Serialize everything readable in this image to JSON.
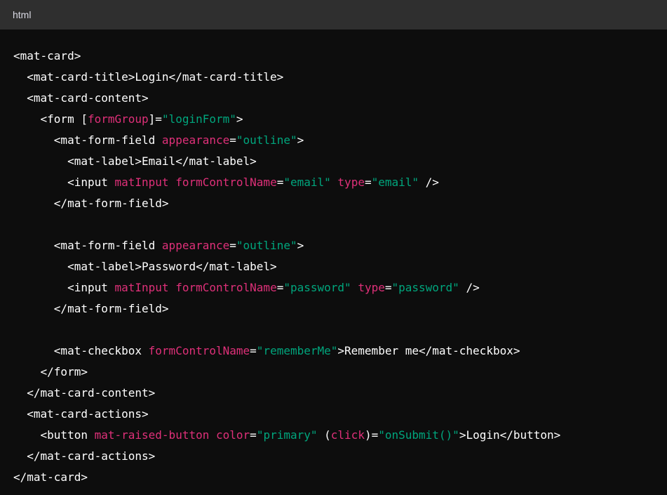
{
  "header": {
    "language": "html"
  },
  "colors": {
    "header_bg": "#2f2f2f",
    "code_bg": "#0d0d0d",
    "tag": "#ffffff",
    "attribute": "#df3079",
    "string": "#00a67d"
  },
  "code_lines": [
    [
      {
        "t": "t",
        "v": "<mat-card>"
      }
    ],
    [
      {
        "t": "t",
        "v": "  <mat-card-title>Login</mat-card-title>"
      }
    ],
    [
      {
        "t": "t",
        "v": "  <mat-card-content>"
      }
    ],
    [
      {
        "t": "t",
        "v": "    <form ["
      },
      {
        "t": "a",
        "v": "formGroup"
      },
      {
        "t": "t",
        "v": "]="
      },
      {
        "t": "s",
        "v": "\"loginForm\""
      },
      {
        "t": "t",
        "v": ">"
      }
    ],
    [
      {
        "t": "t",
        "v": "      <mat-form-field "
      },
      {
        "t": "a",
        "v": "appearance"
      },
      {
        "t": "t",
        "v": "="
      },
      {
        "t": "s",
        "v": "\"outline\""
      },
      {
        "t": "t",
        "v": ">"
      }
    ],
    [
      {
        "t": "t",
        "v": "        <mat-label>Email</mat-label>"
      }
    ],
    [
      {
        "t": "t",
        "v": "        <input "
      },
      {
        "t": "a",
        "v": "matInput"
      },
      {
        "t": "t",
        "v": " "
      },
      {
        "t": "a",
        "v": "formControlName"
      },
      {
        "t": "t",
        "v": "="
      },
      {
        "t": "s",
        "v": "\"email\""
      },
      {
        "t": "t",
        "v": " "
      },
      {
        "t": "a",
        "v": "type"
      },
      {
        "t": "t",
        "v": "="
      },
      {
        "t": "s",
        "v": "\"email\""
      },
      {
        "t": "t",
        "v": " />"
      }
    ],
    [
      {
        "t": "t",
        "v": "      </mat-form-field>"
      }
    ],
    [
      {
        "t": "t",
        "v": ""
      }
    ],
    [
      {
        "t": "t",
        "v": "      <mat-form-field "
      },
      {
        "t": "a",
        "v": "appearance"
      },
      {
        "t": "t",
        "v": "="
      },
      {
        "t": "s",
        "v": "\"outline\""
      },
      {
        "t": "t",
        "v": ">"
      }
    ],
    [
      {
        "t": "t",
        "v": "        <mat-label>Password</mat-label>"
      }
    ],
    [
      {
        "t": "t",
        "v": "        <input "
      },
      {
        "t": "a",
        "v": "matInput"
      },
      {
        "t": "t",
        "v": " "
      },
      {
        "t": "a",
        "v": "formControlName"
      },
      {
        "t": "t",
        "v": "="
      },
      {
        "t": "s",
        "v": "\"password\""
      },
      {
        "t": "t",
        "v": " "
      },
      {
        "t": "a",
        "v": "type"
      },
      {
        "t": "t",
        "v": "="
      },
      {
        "t": "s",
        "v": "\"password\""
      },
      {
        "t": "t",
        "v": " />"
      }
    ],
    [
      {
        "t": "t",
        "v": "      </mat-form-field>"
      }
    ],
    [
      {
        "t": "t",
        "v": ""
      }
    ],
    [
      {
        "t": "t",
        "v": "      <mat-checkbox "
      },
      {
        "t": "a",
        "v": "formControlName"
      },
      {
        "t": "t",
        "v": "="
      },
      {
        "t": "s",
        "v": "\"rememberMe\""
      },
      {
        "t": "t",
        "v": ">Remember me</mat-checkbox>"
      }
    ],
    [
      {
        "t": "t",
        "v": "    </form>"
      }
    ],
    [
      {
        "t": "t",
        "v": "  </mat-card-content>"
      }
    ],
    [
      {
        "t": "t",
        "v": "  <mat-card-actions>"
      }
    ],
    [
      {
        "t": "t",
        "v": "    <button "
      },
      {
        "t": "a",
        "v": "mat-raised-button"
      },
      {
        "t": "t",
        "v": " "
      },
      {
        "t": "a",
        "v": "color"
      },
      {
        "t": "t",
        "v": "="
      },
      {
        "t": "s",
        "v": "\"primary\""
      },
      {
        "t": "t",
        "v": " ("
      },
      {
        "t": "a",
        "v": "click"
      },
      {
        "t": "t",
        "v": ")="
      },
      {
        "t": "s",
        "v": "\"onSubmit()\""
      },
      {
        "t": "t",
        "v": ">Login</button>"
      }
    ],
    [
      {
        "t": "t",
        "v": "  </mat-card-actions>"
      }
    ],
    [
      {
        "t": "t",
        "v": "</mat-card>"
      }
    ]
  ]
}
